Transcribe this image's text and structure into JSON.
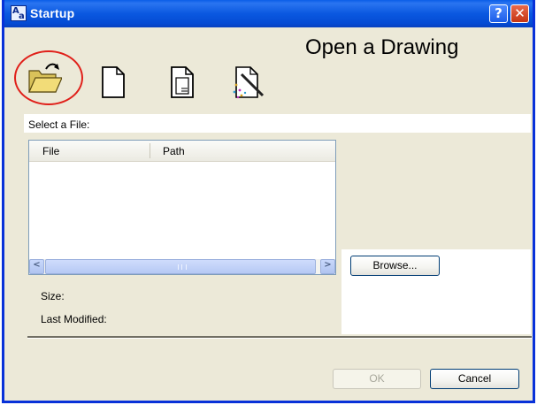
{
  "window": {
    "title": "Startup",
    "help_label": "?",
    "close_label": "✕"
  },
  "toolbar": {
    "items": [
      {
        "name": "open-drawing",
        "icon": "open-folder-icon"
      },
      {
        "name": "start-from-scratch",
        "icon": "blank-page-icon"
      },
      {
        "name": "use-template",
        "icon": "template-page-icon"
      },
      {
        "name": "use-wizard",
        "icon": "wizard-icon"
      }
    ],
    "highlight_color": "#e0201a"
  },
  "heading": "Open a Drawing",
  "file_list": {
    "label": "Select a File:",
    "columns": [
      "File",
      "Path"
    ],
    "rows": [],
    "scroll_left": "<",
    "scroll_right": ">"
  },
  "buttons": {
    "browse": "Browse...",
    "ok": "OK",
    "cancel": "Cancel"
  },
  "info": {
    "size_label": "Size:",
    "last_modified_label": "Last Modified:"
  }
}
